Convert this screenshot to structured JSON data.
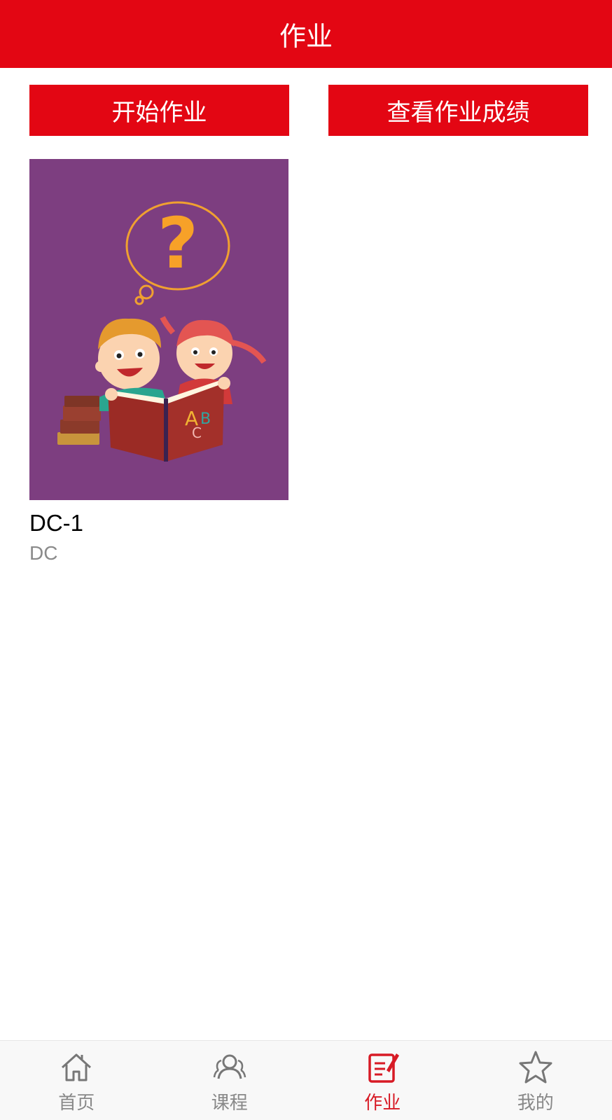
{
  "header": {
    "title": "作业"
  },
  "actions": {
    "start_label": "开始作业",
    "scores_label": "查看作业成绩"
  },
  "homework_list": [
    {
      "title": "DC-1",
      "subtitle": "DC",
      "cover_letters": [
        "A",
        "B",
        "C"
      ],
      "cover_symbol": "?"
    }
  ],
  "tabbar": {
    "items": [
      {
        "label": "首页",
        "icon": "home-icon"
      },
      {
        "label": "课程",
        "icon": "users-icon"
      },
      {
        "label": "作业",
        "icon": "homework-icon",
        "active": true
      },
      {
        "label": "我的",
        "icon": "star-icon"
      }
    ]
  },
  "colors": {
    "accent": "#e30613",
    "active_tab": "#d71a25",
    "cover_bg": "#7d3e80"
  }
}
